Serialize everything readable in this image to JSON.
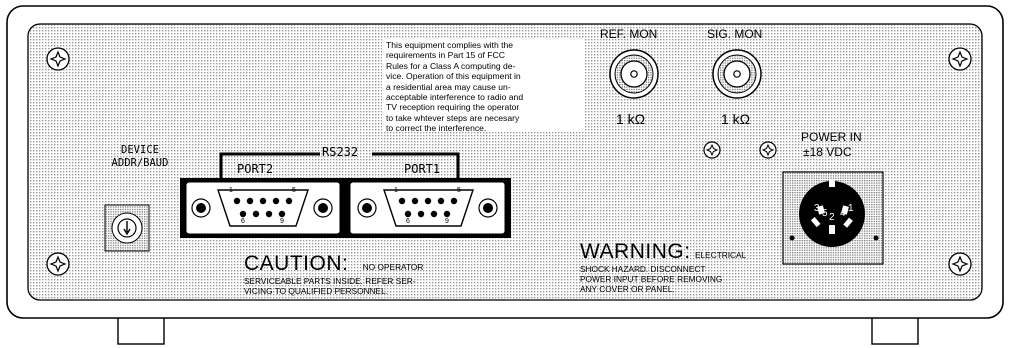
{
  "fcc_notice": {
    "lines": [
      "This equipment complies with the",
      "requirements in Part 15 of FCC",
      "Rules for a Class A computing de-",
      "vice. Operation of this equipment in",
      "a residential area may cause un-",
      "acceptable interference to radio and",
      "TV reception requiring the operator",
      "to take whtever steps are necesary",
      "to correct the interference."
    ]
  },
  "ref_mon": {
    "label": "REF. MON",
    "impedance": "1 kΩ"
  },
  "sig_mon": {
    "label": "SIG. MON",
    "impedance": "1 kΩ"
  },
  "device": {
    "line1": "DEVICE",
    "line2": "ADDR/BAUD"
  },
  "rs232": {
    "label": "RS232",
    "port2": {
      "label": "PORT2",
      "pin_top_left": "1",
      "pin_top_right": "5",
      "pin_bottom_left": "6",
      "pin_bottom_right": "9"
    },
    "port1": {
      "label": "PORT1",
      "pin_top_left": "1",
      "pin_top_right": "5",
      "pin_bottom_left": "6",
      "pin_bottom_right": "9"
    }
  },
  "power": {
    "label": "POWER IN",
    "voltage": "±18 VDC",
    "pins": [
      "3",
      "5",
      "2",
      "4",
      "1"
    ]
  },
  "caution": {
    "title": "CAUTION:",
    "line1": "NO   OPERATOR",
    "line2": "SERVICEABLE PARTS INSIDE. REFER SER-",
    "line3": "VICING TO QUALIFIED PERSONNEL."
  },
  "warning": {
    "title": "WARNING:",
    "line1": "ELECTRICAL",
    "line2": "SHOCK    HAZARD.   DISCONNECT",
    "line3": "POWER INPUT BEFORE  REMOVING",
    "line4": "ANY COVER OR PANEL."
  },
  "colors": {
    "panel": "#dcdcdc",
    "ink": "#000000",
    "rotary_switch": "#ffffff"
  }
}
